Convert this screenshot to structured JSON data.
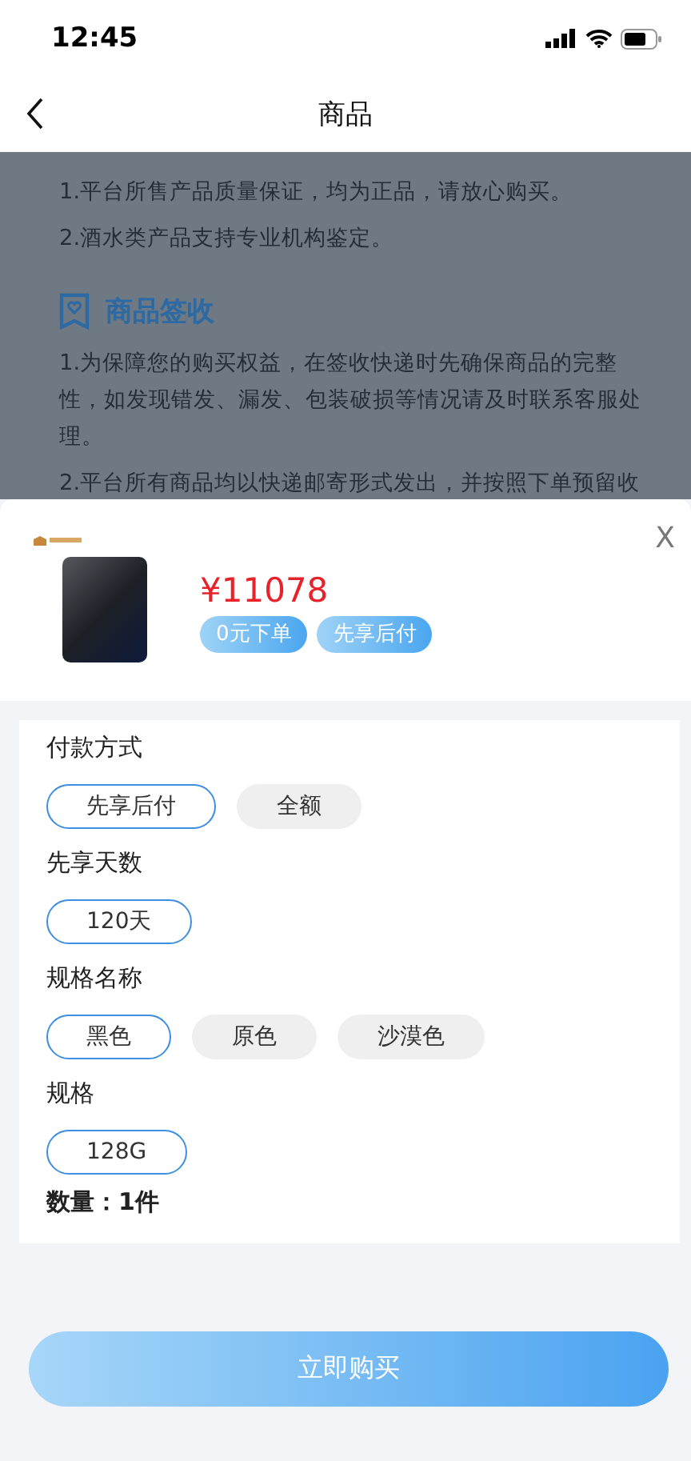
{
  "status_bar": {
    "time": "12:45"
  },
  "nav": {
    "title": "商品"
  },
  "article": {
    "sections": [
      {
        "lines": [
          "1.平台所售产品质量保证，均为正品，请放心购买。",
          "2.酒水类产品支持专业机构鉴定。"
        ]
      },
      {
        "title": "商品签收",
        "lines": [
          "1.为保障您的购买权益，在签收快递时先确保商品的完整性，如发现错发、漏发、包装破损等情况请及时联系客服处理。",
          "2.平台所有商品均以快递邮寄形式发出，并按照下单预留收"
        ]
      }
    ]
  },
  "sheet": {
    "close": "X",
    "price": "¥11078",
    "tags": [
      "0元下单",
      "先享后付"
    ],
    "groups": [
      {
        "title": "付款方式",
        "options": [
          {
            "label": "先享后付",
            "selected": true
          },
          {
            "label": "全额",
            "selected": false
          }
        ]
      },
      {
        "title": "先享天数",
        "options": [
          {
            "label": "120天",
            "selected": true
          }
        ]
      },
      {
        "title": "规格名称",
        "options": [
          {
            "label": "黑色",
            "selected": true
          },
          {
            "label": "原色",
            "selected": false
          },
          {
            "label": "沙漠色",
            "selected": false
          }
        ]
      },
      {
        "title": "规格",
        "options": [
          {
            "label": "128G",
            "selected": true
          }
        ]
      }
    ],
    "quantity": "数量：1件",
    "buy_button": "立即购买"
  }
}
